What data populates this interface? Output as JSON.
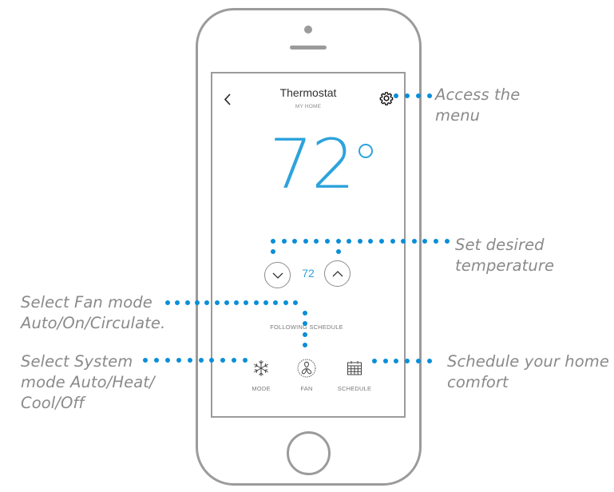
{
  "app": {
    "title": "Thermostat",
    "location": "MY HOME"
  },
  "thermostat": {
    "current_temperature": "72",
    "degree_symbol": "°",
    "setpoint": "72",
    "status": "FOLLOWING SCHEDULE",
    "accent_color": "#2ea3dc"
  },
  "icons": {
    "back": "chevron-left-icon",
    "menu": "gear-icon",
    "decrease": "chevron-down-icon",
    "increase": "chevron-up-icon"
  },
  "bottom_nav": [
    {
      "label": "MODE",
      "icon": "snowflake-icon"
    },
    {
      "label": "FAN",
      "icon": "fan-icon"
    },
    {
      "label": "SCHEDULE",
      "icon": "calendar-icon"
    }
  ],
  "callouts": {
    "menu": [
      "Access the",
      "menu"
    ],
    "temperature": [
      "Set desired",
      "temperature"
    ],
    "fan": [
      "Select Fan mode",
      "Auto/On/Circulate."
    ],
    "system": [
      "Select System",
      "mode Auto/Heat/",
      "Cool/Off"
    ],
    "schedule": [
      "Schedule your home",
      "comfort"
    ],
    "line_color": "#0a8ed8"
  }
}
